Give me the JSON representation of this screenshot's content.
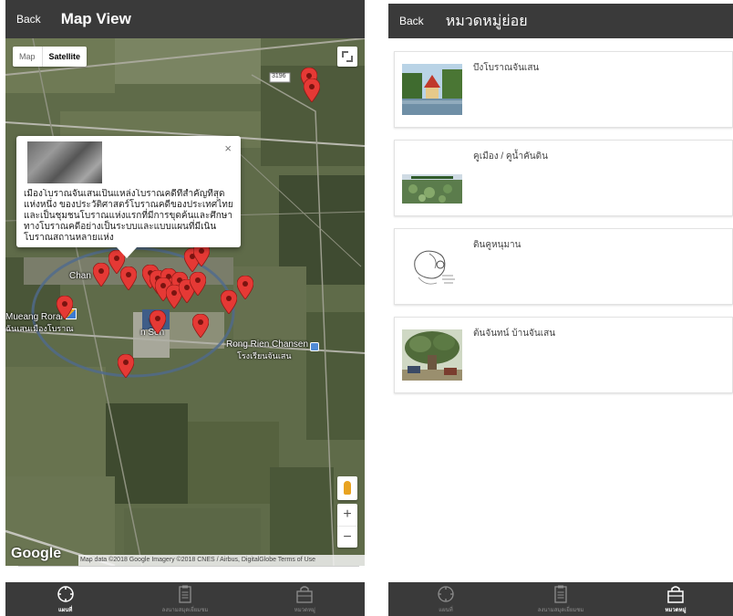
{
  "left": {
    "header": {
      "back_label": "Back",
      "title": "Map View"
    },
    "map": {
      "type_map": "Map",
      "type_satellite": "Satellite",
      "info_window": {
        "text": "เมืองโบราณจันเสนเป็นแหล่งโบราณคดีที่สำคัญที่สุดแห่งหนึ่ง ของประวัติศาสตร์โบราณคดีของประเทศไทย และเป็นชุมชนโบราณแห่งแรกที่มีการขุดค้นและศึกษาทางโบราณคดีอย่างเป็นระบบและแบบแผนที่มีเนินโบราณสถานหลายแห่ง",
        "close": "×"
      },
      "labels": {
        "road": "3196",
        "chan": "Chan",
        "wat": "Wa",
        "sen": "n Sen",
        "mueang": "Mueang Roran",
        "mueang_th": "ฉันเสนเมืองโบราณ",
        "school": "Rong Rien Chansen",
        "school_th": "โรงเรียนจันเสน"
      },
      "zoom_in": "+",
      "zoom_out": "−",
      "google": "Google",
      "attribution": "Map data ©2018 Google Imagery ©2018 CNES / Airbus, DigitalGlobe   Terms of Use"
    },
    "tabs": [
      {
        "label": "แผนที่",
        "icon": "compass-icon"
      },
      {
        "label": "ลงนามสมุดเยี่ยมชม",
        "icon": "clipboard-icon"
      },
      {
        "label": "หมวดหมู่",
        "icon": "bag-icon"
      }
    ]
  },
  "right": {
    "header": {
      "back_label": "Back",
      "title": "หมวดหมู่ย่อย"
    },
    "items": [
      {
        "title": "บึงโบราณจันเสน",
        "thumb": "pavilion-photo"
      },
      {
        "title": "คูเมือง / คูน้ำคันดิน",
        "thumb": "lotus-pond-photo"
      },
      {
        "title": "ดินคูหนุมาน",
        "thumb": "hanuman-sketch"
      },
      {
        "title": "ต้นจันทน์ บ้านจันเสน",
        "thumb": "tree-photo"
      }
    ],
    "tabs": [
      {
        "label": "แผนที่",
        "icon": "compass-icon"
      },
      {
        "label": "ลงนามสมุดเยี่ยมชม",
        "icon": "clipboard-icon"
      },
      {
        "label": "หมวดหมู่",
        "icon": "bag-icon"
      }
    ]
  },
  "colors": {
    "header": "#3a3a3a",
    "marker": "#e53935",
    "satellite_field": "#5d6a48"
  }
}
